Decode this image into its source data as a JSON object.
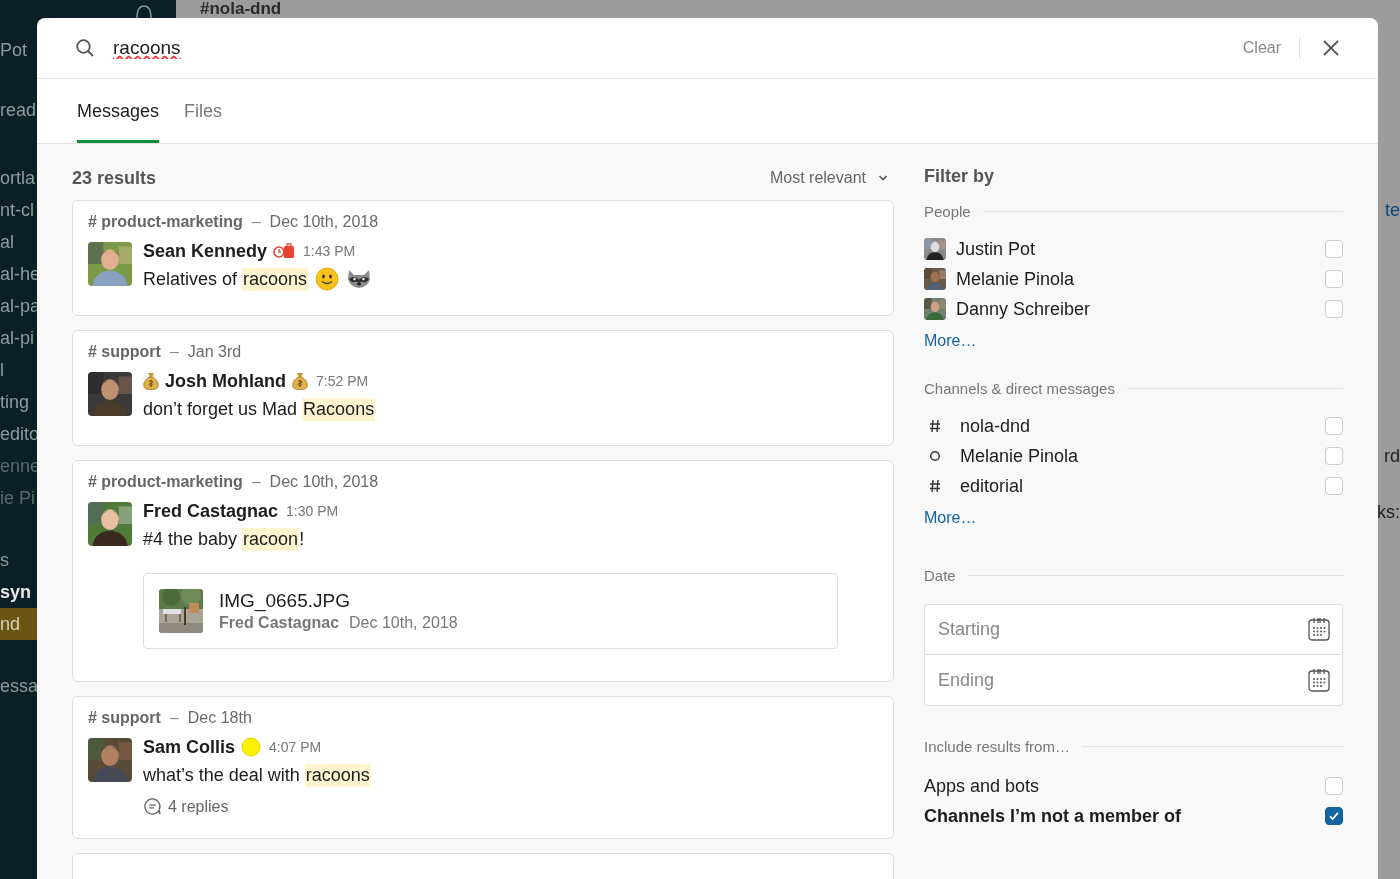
{
  "backdrop": {
    "channel_title": "#nola-dnd",
    "sidebar_sections": [
      [
        {
          "label": "Pot",
          "selected": false,
          "bold": false,
          "dim": false
        },
        {
          "label": "read",
          "selected": false,
          "bold": false,
          "dim": false
        }
      ],
      [
        {
          "label": "ortla",
          "selected": false,
          "bold": false,
          "dim": false
        },
        {
          "label": "nt-cl",
          "selected": false,
          "bold": false,
          "dim": false
        },
        {
          "label": "al",
          "selected": false,
          "bold": false,
          "dim": false
        },
        {
          "label": "al-he",
          "selected": false,
          "bold": false,
          "dim": false
        },
        {
          "label": "al-pa",
          "selected": false,
          "bold": false,
          "dim": false
        },
        {
          "label": "al-pi",
          "selected": false,
          "bold": false,
          "dim": false
        },
        {
          "label": "l",
          "selected": false,
          "bold": false,
          "dim": false
        },
        {
          "label": "ting",
          "selected": false,
          "bold": false,
          "dim": false
        },
        {
          "label": "edito",
          "selected": false,
          "bold": false,
          "dim": false
        },
        {
          "label": "enne",
          "selected": false,
          "bold": false,
          "dim": true
        },
        {
          "label": "ie Pi",
          "selected": false,
          "bold": false,
          "dim": true
        }
      ],
      [
        {
          "label": "s",
          "selected": false,
          "bold": false,
          "dim": false
        },
        {
          "label": "syn",
          "selected": false,
          "bold": true,
          "dim": false
        },
        {
          "label": "nd",
          "selected": true,
          "bold": false,
          "dim": false
        }
      ],
      [
        {
          "label": "essa",
          "selected": false,
          "bold": false,
          "dim": false
        }
      ]
    ],
    "right_texts": [
      {
        "text": "te",
        "kind": "link"
      },
      {
        "text": "rd",
        "kind": "text"
      },
      {
        "text": "ks:",
        "kind": "text"
      }
    ]
  },
  "search": {
    "value": "racoons",
    "clear": "Clear"
  },
  "tabs": [
    {
      "label": "Messages",
      "selected": true
    },
    {
      "label": "Files",
      "selected": false
    }
  ],
  "results": {
    "count": "23 results",
    "sort": "Most relevant"
  },
  "messages": [
    {
      "channel": "# product-marketing",
      "separator": "–",
      "date": "Dec 10th, 2018",
      "author": "Sean Kennedy",
      "badges_after": [
        {
          "kind": "travel"
        }
      ],
      "time": "1:43 PM",
      "body": [
        {
          "kind": "text",
          "text": "Relatives of "
        },
        {
          "kind": "match",
          "text": "racoons"
        },
        {
          "kind": "smile"
        },
        {
          "kind": "raccoon"
        }
      ]
    },
    {
      "channel": "# support",
      "separator": "–",
      "date": "Jan 3rd",
      "author": "Josh Mohland",
      "badges_before": [
        {
          "kind": "money"
        }
      ],
      "badges_after": [
        {
          "kind": "money"
        }
      ],
      "time": "7:52 PM",
      "body": [
        {
          "kind": "text",
          "text": "don’t forget us Mad "
        },
        {
          "kind": "match",
          "text": "Racoons"
        }
      ]
    },
    {
      "channel": "# product-marketing",
      "separator": "–",
      "date": "Dec 10th, 2018",
      "author": "Fred Castagnac",
      "time": "1:30 PM",
      "body": [
        {
          "kind": "text",
          "text": "#4 the baby "
        },
        {
          "kind": "match",
          "text": "racoon"
        },
        {
          "kind": "text",
          "text": "!"
        }
      ],
      "attachment": {
        "name": "IMG_0665.JPG",
        "author": "Fred Castagnac",
        "date": "Dec 10th, 2018"
      }
    },
    {
      "channel": "# support",
      "separator": "–",
      "date": "Dec 18th",
      "author": "Sam Collis",
      "badges_after": [
        {
          "kind": "yellow-dot"
        }
      ],
      "time": "4:07 PM",
      "body": [
        {
          "kind": "text",
          "text": "what’s the deal with "
        },
        {
          "kind": "match",
          "text": "racoons"
        }
      ],
      "replies": "4 replies"
    },
    {
      "kind": "partial"
    }
  ],
  "filter": {
    "title": "Filter by",
    "people": {
      "heading": "People",
      "items": [
        {
          "name": "Justin Pot",
          "checked": false
        },
        {
          "name": "Melanie Pinola",
          "checked": false
        },
        {
          "name": "Danny Schreiber",
          "checked": false
        }
      ],
      "more": "More…"
    },
    "channels": {
      "heading": "Channels & direct messages",
      "items": [
        {
          "kind": "channel",
          "name": "nola-dnd",
          "checked": false
        },
        {
          "kind": "dm",
          "name": "Melanie Pinola",
          "checked": false
        },
        {
          "kind": "channel",
          "name": "editorial",
          "checked": false
        }
      ],
      "more": "More…"
    },
    "date": {
      "heading": "Date",
      "fields": [
        {
          "placeholder": "Starting"
        },
        {
          "placeholder": "Ending"
        }
      ]
    },
    "include": {
      "heading": "Include results from…",
      "items": [
        {
          "label": "Apps and bots",
          "checked": false,
          "bold": false
        },
        {
          "label": "Channels I’m not a member of",
          "checked": true,
          "bold": true
        }
      ]
    }
  }
}
